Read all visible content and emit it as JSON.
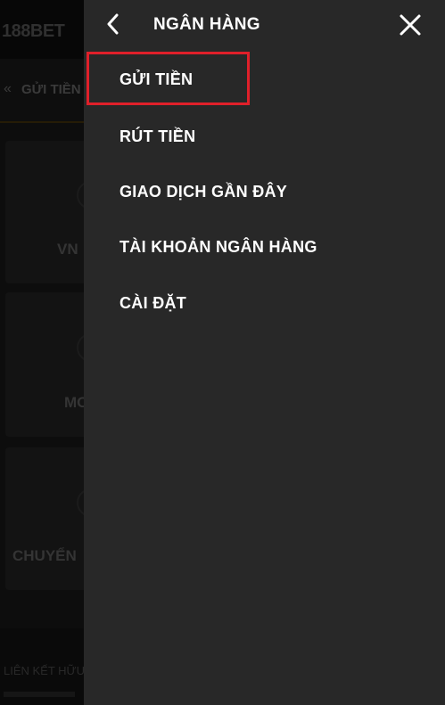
{
  "background": {
    "logo_text": "188BET",
    "back_glyph": "«",
    "tab_label": "GỬI TIỀN",
    "cards": [
      {
        "label": "VN"
      },
      {
        "label": "MO"
      },
      {
        "label": "CHUYỂN"
      }
    ],
    "footer_label": "LIÊN KẾT HỮU"
  },
  "drawer": {
    "title": "NGÂN HÀNG",
    "back_icon": "chevron-left-icon",
    "close_icon": "close-icon",
    "items": [
      {
        "label": "GỬI TIỀN",
        "highlighted": true
      },
      {
        "label": "RÚT TIỀN"
      },
      {
        "label": "GIAO DỊCH GẦN ĐÂY"
      },
      {
        "label": "TÀI KHOẢN NGÂN HÀNG"
      },
      {
        "label": "CÀI ĐẶT"
      }
    ],
    "highlight_color": "#e0202a"
  },
  "colors": {
    "drawer_bg": "#282828",
    "text": "#ffffff"
  }
}
